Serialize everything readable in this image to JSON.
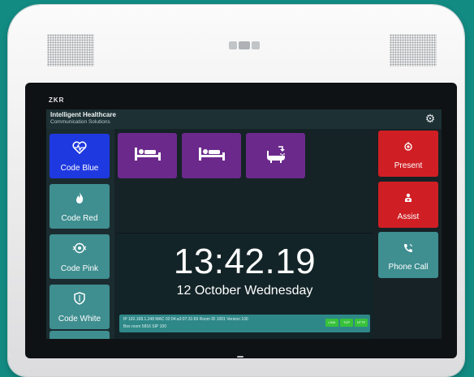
{
  "device": {
    "brand": "ZKR"
  },
  "header": {
    "title": "Intelligent Healthcare",
    "subtitle": "Communication Solutions",
    "settings_icon": "gear-icon"
  },
  "left_buttons": [
    {
      "label": "Code Blue",
      "icon": "heart-pulse-icon",
      "color": "#1f39e0"
    },
    {
      "label": "Code Red",
      "icon": "flame-icon",
      "color": "#3f8e90"
    },
    {
      "label": "Code Pink",
      "icon": "baby-icon",
      "color": "#3f8e90"
    },
    {
      "label": "Code White",
      "icon": "shield-icon",
      "color": "#3f8e90"
    }
  ],
  "bed_buttons": [
    {
      "icon": "patient-bed-icon"
    },
    {
      "icon": "patient-bed-icon"
    },
    {
      "icon": "bathtub-shower-icon"
    }
  ],
  "clock": {
    "time": "13:42.19",
    "date": "12 October Wednesday"
  },
  "info": {
    "line1": "IP 192.168.1.248   MAC 02:04:a3:07:31:69   Room ID 1001   Version 100",
    "line2": "Box room 5816   SIP 100",
    "statuses": [
      "LINK",
      "TCP",
      "HTTP"
    ],
    "status_color": "#37c23a"
  },
  "right_buttons": [
    {
      "label": "Present",
      "icon": "present-icon",
      "color": "#cf1f24"
    },
    {
      "label": "Assist",
      "icon": "assist-icon",
      "color": "#cf1f24"
    },
    {
      "label": "Phone Call",
      "icon": "phone-icon",
      "color": "#3f8e90"
    }
  ]
}
